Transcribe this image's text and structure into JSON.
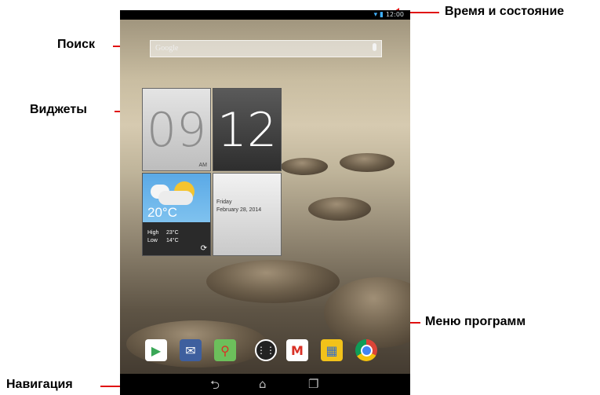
{
  "callouts": {
    "time_status": "Время и состояние",
    "search": "Поиск",
    "widgets": "Виджеты",
    "app_menu": "Меню программ",
    "navigation": "Навигация"
  },
  "search": {
    "placeholder": "Google"
  },
  "clock": {
    "hour": "09",
    "minute": "12",
    "ampm": "AM"
  },
  "weather": {
    "temp": "20°C",
    "high_label": "High",
    "high": "23°C",
    "low_label": "Low",
    "low": "14°C"
  },
  "date": {
    "day": "Friday",
    "full_date": "February 28, 2014"
  },
  "dock": {
    "apps": [
      "play-store",
      "email",
      "maps",
      "app-drawer",
      "gmail",
      "gallery",
      "chrome"
    ]
  },
  "colors": {
    "callout_arrow": "#e01010",
    "status_icon": "#3fb0ff"
  }
}
